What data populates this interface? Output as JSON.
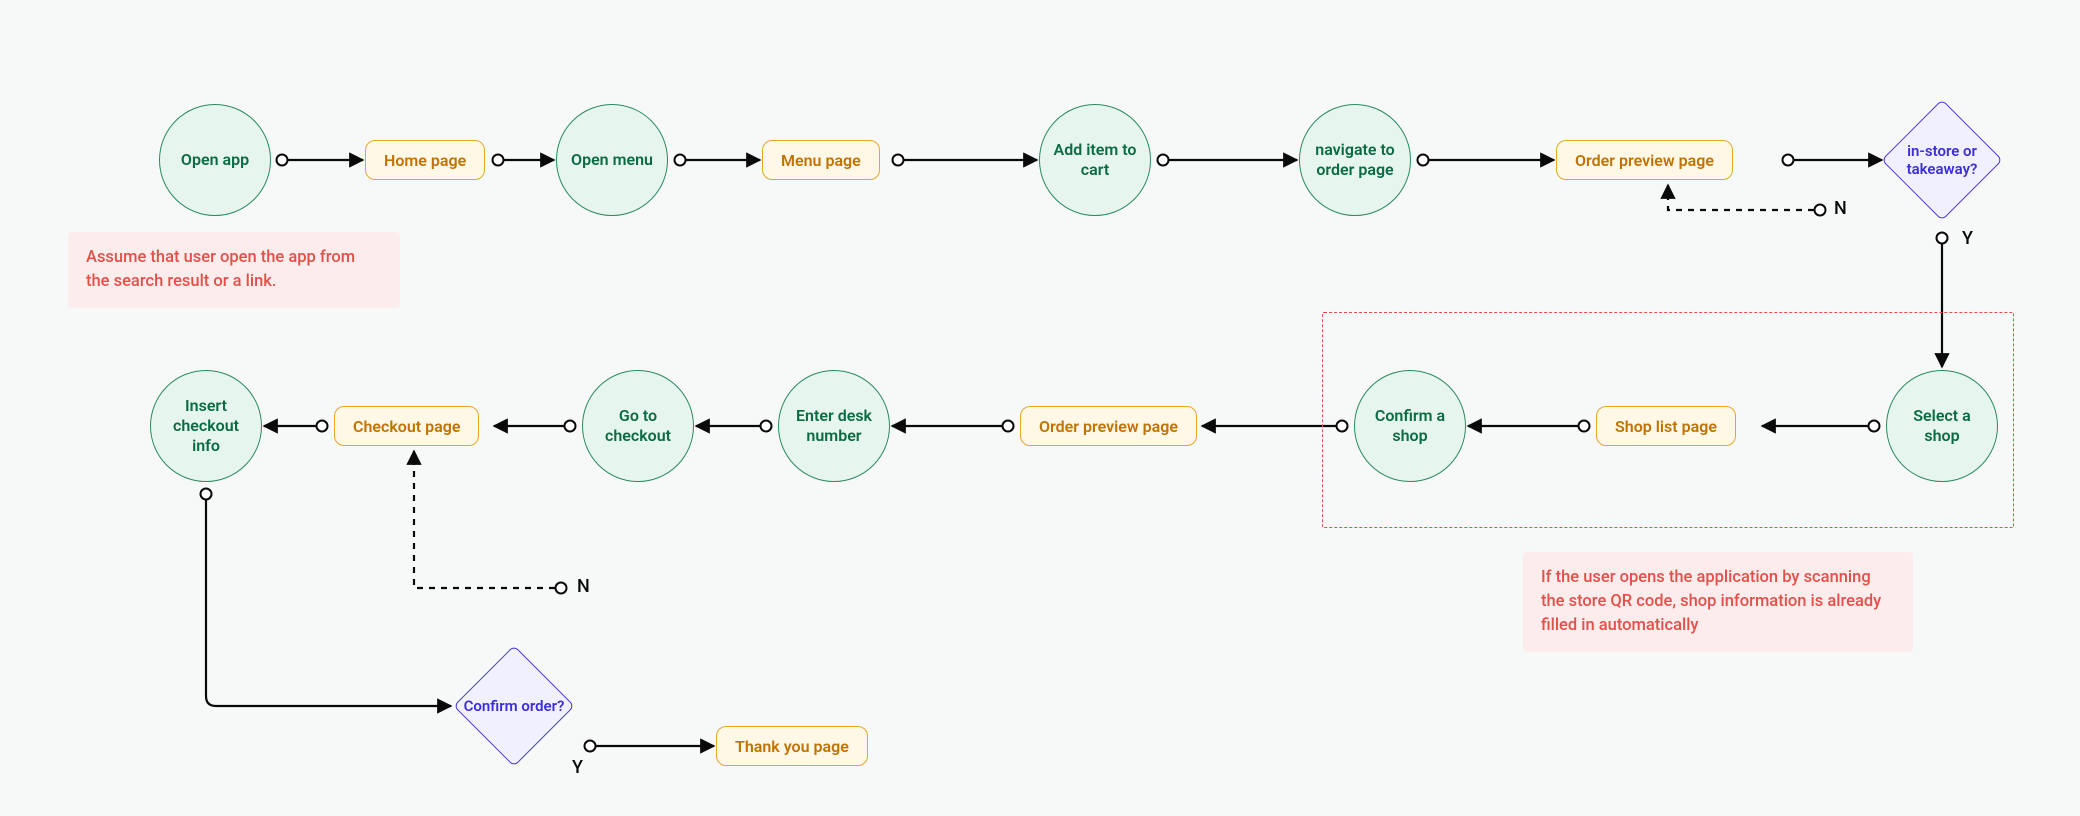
{
  "nodes": {
    "open_app": "Open app",
    "home_page": "Home page",
    "open_menu": "Open menu",
    "menu_page": "Menu page",
    "add_item": "Add item to cart",
    "nav_order": "navigate to order page",
    "order_preview1": "Order preview page",
    "decision_store": "in-store or takeaway?",
    "select_shop": "Select a shop",
    "shop_list": "Shop list page",
    "confirm_shop": "Confirm a shop",
    "order_preview2": "Order preview page",
    "enter_desk": "Enter desk number",
    "goto_checkout": "Go to checkout",
    "checkout_page": "Checkout page",
    "insert_checkout": "Insert checkout info",
    "decision_confirm": "Confirm order?",
    "thank_you": "Thank you page"
  },
  "labels": {
    "y1": "Y",
    "n1": "N",
    "y2": "Y",
    "n2": "N"
  },
  "notes": {
    "note1": "Assume that user open the app from the search result or a link.",
    "note2": "If the user opens the application by scanning the store QR code, shop information is already filled in automatically"
  }
}
